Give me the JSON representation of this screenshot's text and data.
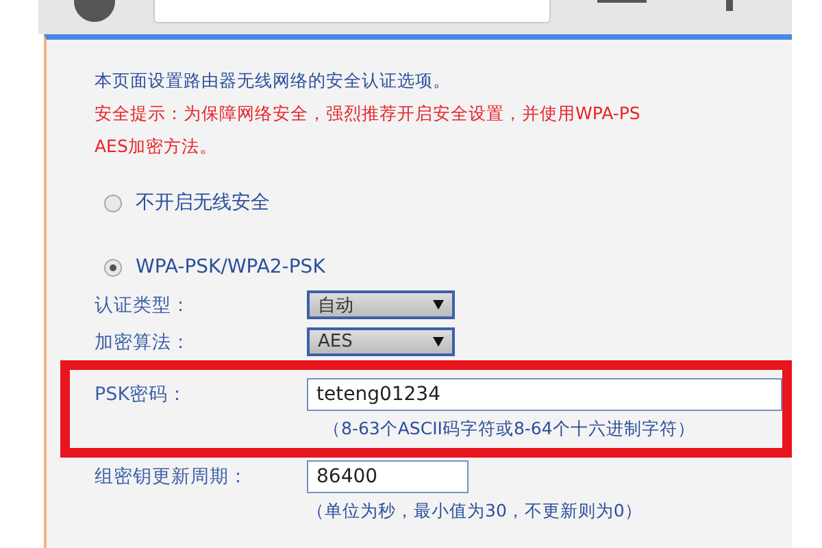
{
  "intro": "本页面设置路由器无线网络的安全认证选项。",
  "warning_lines": [
    "安全提示：为保障网络安全，强烈推荐开启安全设置，并使用WPA-PS",
    "AES加密方法。"
  ],
  "security_options": [
    {
      "label": "不开启无线安全",
      "selected": false
    },
    {
      "label": "WPA-PSK/WPA2-PSK",
      "selected": true
    }
  ],
  "settings": [
    {
      "label": "认证类型：",
      "kind": "select",
      "value": "自动",
      "highlighted": false
    },
    {
      "label": "加密算法：",
      "kind": "select",
      "value": "AES",
      "highlighted": false
    },
    {
      "label": "PSK密码：",
      "kind": "input",
      "value": "teteng01234",
      "hint": "（8-63个ASCII码字符或8-64个十六进制字符）",
      "highlighted": true
    },
    {
      "label": "组密钥更新周期：",
      "kind": "short-input",
      "value": "86400",
      "hint": "（单位为秒，最小值为30，不更新则为0）",
      "highlighted": false
    }
  ]
}
